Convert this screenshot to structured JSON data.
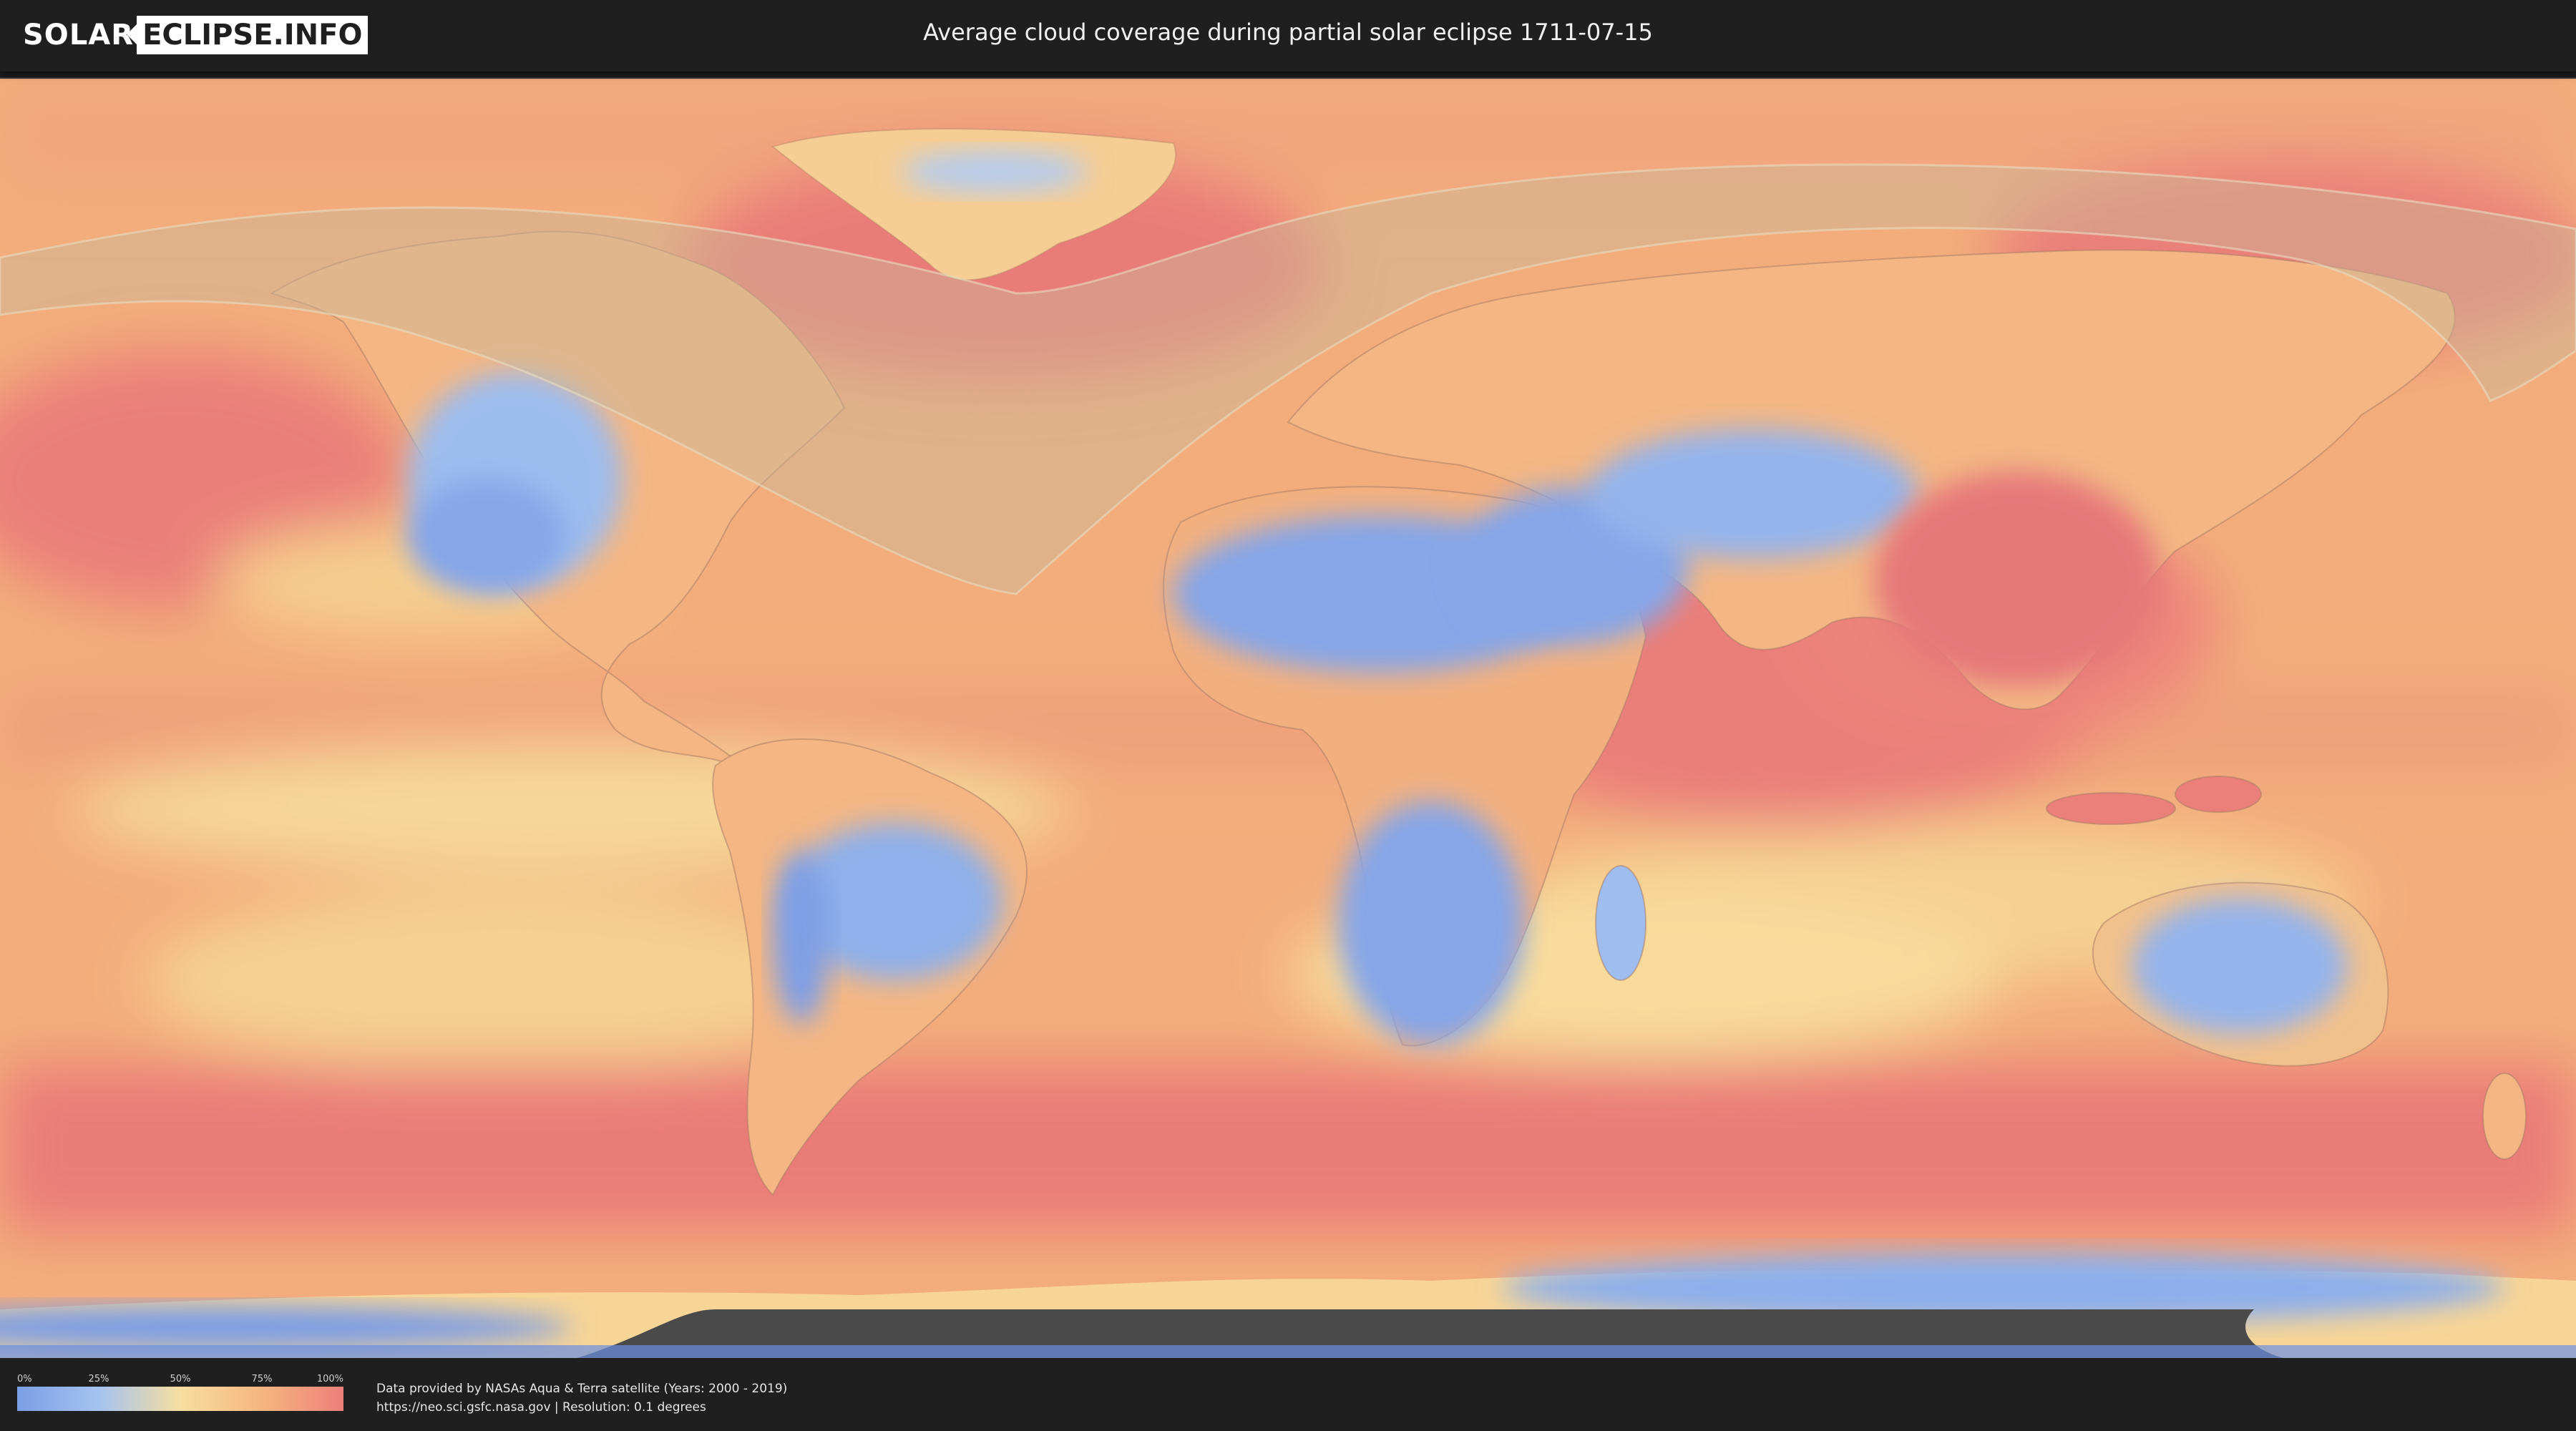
{
  "header": {
    "logo_left": "SOLAR",
    "logo_right": "ECLIPSE.INFO",
    "title": "Average cloud coverage during partial solar eclipse 1711-07-15"
  },
  "map": {
    "palette": {
      "very_cloudy": "#ec7d78",
      "cloudy": "#f4a77a",
      "medium": "#f6cf8e",
      "clear": "#a9c6ee",
      "very_clear": "#7a9ce6",
      "no_data": "#4a4a4a",
      "eclipse_overlay": "#c9b89a"
    }
  },
  "legend": {
    "ticks": [
      "0%",
      "25%",
      "50%",
      "75%",
      "100%"
    ],
    "tick_values": [
      0,
      0.25,
      0.5,
      0.75,
      1.0
    ],
    "colors": [
      "#7b9fe6",
      "#a5c3f0",
      "#f6dea0",
      "#f6b680",
      "#ed7f7a"
    ]
  },
  "footer": {
    "credit_line1": "Data provided by NASAs Aqua & Terra satellite (Years: 2000 - 2019)",
    "credit_line2": "https://neo.sci.gsfc.nasa.gov | Resolution: 0.1 degrees"
  }
}
